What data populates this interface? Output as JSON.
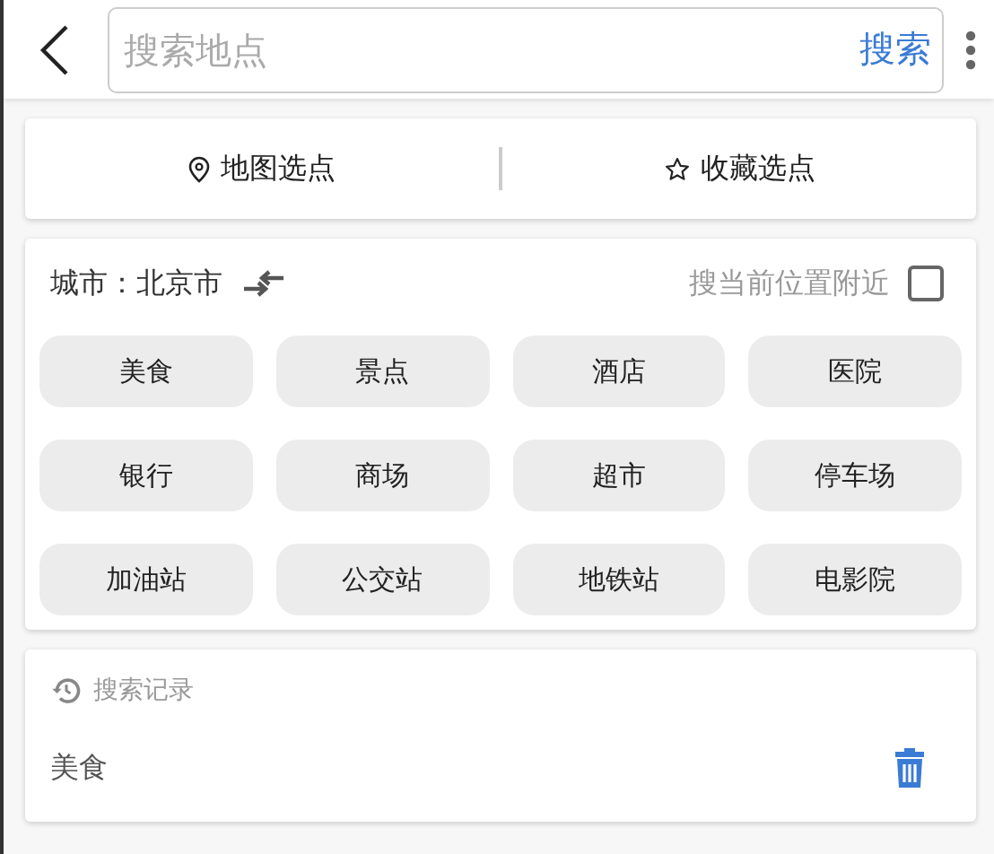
{
  "search": {
    "placeholder": "搜索地点",
    "button": "搜索"
  },
  "pick_options": [
    {
      "kind": "map",
      "label": "地图选点"
    },
    {
      "kind": "favorite",
      "label": "收藏选点"
    }
  ],
  "city": {
    "label": "城市：北京市",
    "nearby_label": "搜当前位置附近",
    "nearby_checked": false
  },
  "categories": [
    "美食",
    "景点",
    "酒店",
    "医院",
    "银行",
    "商场",
    "超市",
    "停车场",
    "加油站",
    "公交站",
    "地铁站",
    "电影院"
  ],
  "history": {
    "title": "搜索记录",
    "items": [
      "美食"
    ]
  }
}
